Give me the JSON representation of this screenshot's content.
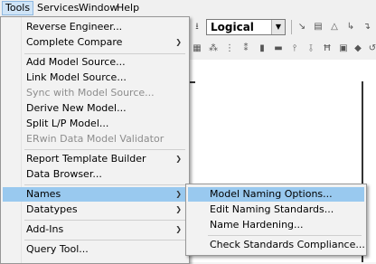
{
  "menubar": {
    "items": [
      {
        "label": "Tools",
        "active": true
      },
      {
        "label": "Services",
        "active": false
      },
      {
        "label": "Window",
        "active": false
      },
      {
        "label": "Help",
        "active": false
      }
    ]
  },
  "toolbar": {
    "view_combo_value": "Logical"
  },
  "tools_menu": {
    "items": [
      {
        "label": "Reverse Engineer..."
      },
      {
        "label": "Complete Compare",
        "submenu": true
      },
      {
        "label": "Add Model Source..."
      },
      {
        "label": "Link Model Source..."
      },
      {
        "label": "Sync with Model Source...",
        "disabled": true
      },
      {
        "label": "Derive New Model..."
      },
      {
        "label": "Split L/P Model..."
      },
      {
        "label": "ERwin Data Model Validator",
        "disabled": true
      },
      {
        "label": "Report Template Builder",
        "submenu": true
      },
      {
        "label": "Data Browser..."
      },
      {
        "label": "Names",
        "submenu": true,
        "highlighted": true
      },
      {
        "label": "Datatypes",
        "submenu": true
      },
      {
        "label": "Add-Ins",
        "submenu": true
      },
      {
        "label": "Query Tool..."
      }
    ]
  },
  "names_submenu": {
    "items": [
      {
        "label": "Model Naming Options...",
        "highlighted": true
      },
      {
        "label": "Edit Naming Standards..."
      },
      {
        "label": "Name Hardening..."
      },
      {
        "label": "Check Standards Compliance..."
      }
    ]
  },
  "colors": {
    "highlight": "#99c9ef",
    "menu_bg": "#f2f2f2"
  }
}
